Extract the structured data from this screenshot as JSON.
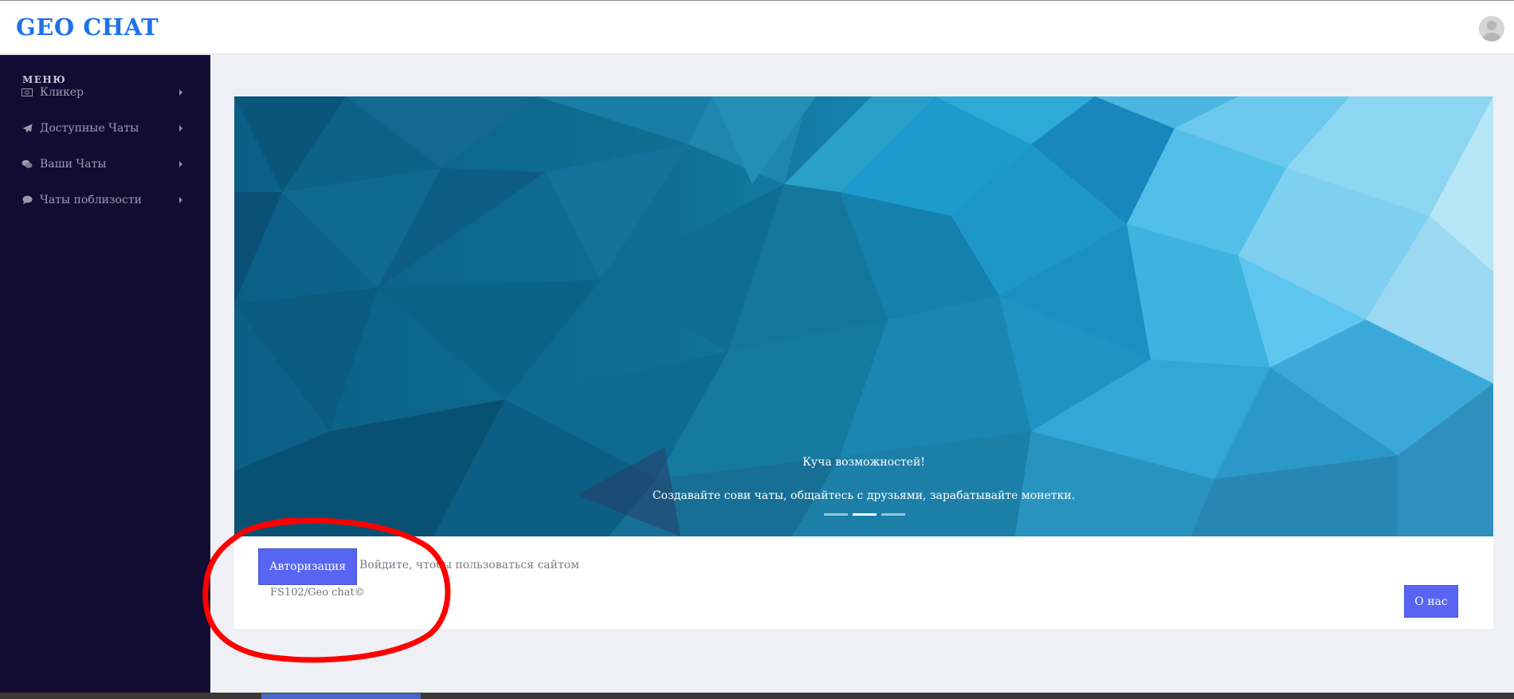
{
  "header": {
    "brand": "GEO CHAT",
    "avatar_icon": "user-avatar-icon"
  },
  "sidebar": {
    "title": "МЕНЮ",
    "items": [
      {
        "label": "Кликер",
        "icon": "money-icon"
      },
      {
        "label": "Доступные Чаты",
        "icon": "paper-plane-icon"
      },
      {
        "label": "Ваши Чаты",
        "icon": "comments-icon"
      },
      {
        "label": "Чаты поблизости",
        "icon": "comment-icon"
      }
    ]
  },
  "carousel": {
    "title": "Куча возможностей!",
    "text": "Создавайте сови чаты, общайтесь с друзьями, зарабатывайте монетки.",
    "slides": 3,
    "active_slide": 2
  },
  "footer": {
    "auth_button": "Авторизация",
    "auth_hint": "Войдите, чтобы пользоваться сайтом",
    "copyright": "FS102/Geo chat©",
    "about_button": "О нас"
  },
  "colors": {
    "brand": "#1d72e8",
    "sidebar_bg": "#120c33",
    "button": "#5865f2",
    "annotation": "#ff0000"
  }
}
